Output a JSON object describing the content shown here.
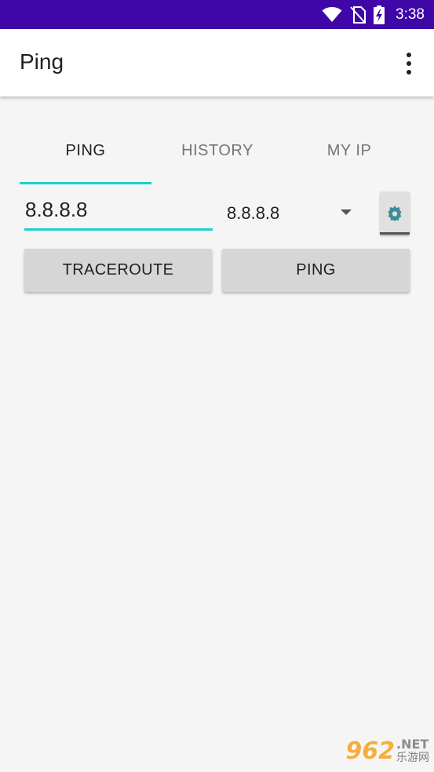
{
  "status_bar": {
    "time": "3:38",
    "background": "#3f06a8",
    "icons": [
      "wifi-icon",
      "no-sim-icon",
      "battery-charging-icon"
    ]
  },
  "app_bar": {
    "title": "Ping",
    "menu_icon": "more-vert-icon"
  },
  "tabs": [
    {
      "label": "PING",
      "active": true
    },
    {
      "label": "HISTORY",
      "active": false
    },
    {
      "label": "MY IP",
      "active": false
    }
  ],
  "accent_color": "#1ad0d0",
  "host_input": {
    "value": "8.8.8.8",
    "placeholder": ""
  },
  "host_spinner": {
    "selected": "8.8.8.8"
  },
  "settings_button": {
    "icon": "gear-icon"
  },
  "buttons": {
    "traceroute_label": "TRACEROUTE",
    "ping_label": "PING"
  },
  "watermark": {
    "number": "962",
    "suffix": ".NET",
    "text": "乐游网"
  }
}
